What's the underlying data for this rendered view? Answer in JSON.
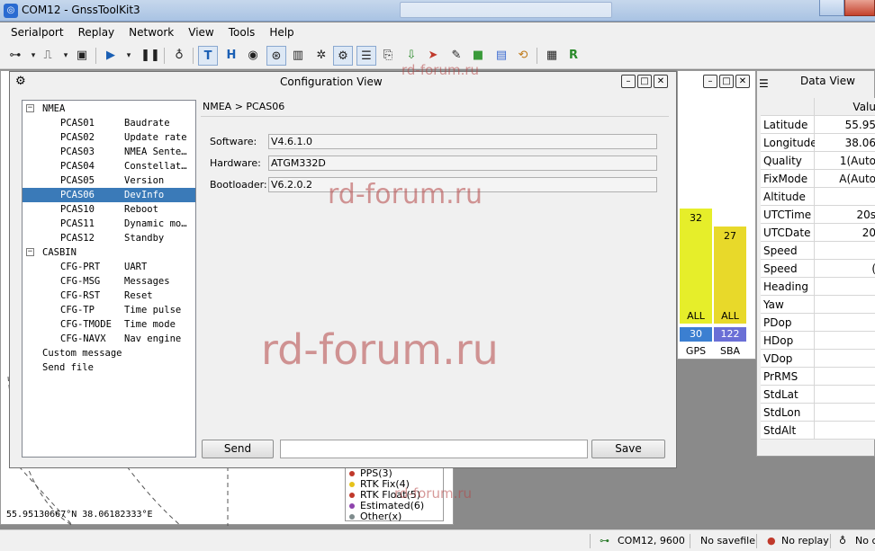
{
  "window": {
    "title": "COM12 - GnssToolKit3"
  },
  "menu": [
    "Serialport",
    "Replay",
    "Network",
    "View",
    "Tools",
    "Help"
  ],
  "toolbar": {
    "icons": [
      "serial-connect-icon",
      "signal-wave-icon",
      "save-icon",
      "play-icon",
      "pause-icon",
      "microphone-icon",
      "text-view-icon",
      "hex-view-icon",
      "compass-icon",
      "target-icon",
      "bar-chart-icon",
      "satellite-icon",
      "gear-icon",
      "list-icon",
      "document-icon",
      "download-icon",
      "arrow-icon",
      "pen-icon",
      "green-box-icon",
      "sbas-icon",
      "refresh-icon",
      "layout-icon",
      "r-box-icon"
    ]
  },
  "config_dialog": {
    "title": "Configuration View",
    "breadcrumb": "NMEA > PCAS06",
    "tree": [
      {
        "level": 0,
        "expand": "−",
        "a": "NMEA",
        "b": ""
      },
      {
        "level": 1,
        "a": "PCAS01",
        "b": "Baudrate"
      },
      {
        "level": 1,
        "a": "PCAS02",
        "b": "Update rate"
      },
      {
        "level": 1,
        "a": "PCAS03",
        "b": "NMEA Sente…"
      },
      {
        "level": 1,
        "a": "PCAS04",
        "b": "Constellat…"
      },
      {
        "level": 1,
        "a": "PCAS05",
        "b": "Version"
      },
      {
        "level": 1,
        "a": "PCAS06",
        "b": "DevInfo",
        "selected": true
      },
      {
        "level": 1,
        "a": "PCAS10",
        "b": "Reboot"
      },
      {
        "level": 1,
        "a": "PCAS11",
        "b": "Dynamic mo…"
      },
      {
        "level": 1,
        "a": "PCAS12",
        "b": "Standby"
      },
      {
        "level": 0,
        "expand": "−",
        "a": "CASBIN",
        "b": ""
      },
      {
        "level": 1,
        "a": "CFG-PRT",
        "b": "UART"
      },
      {
        "level": 1,
        "a": "CFG-MSG",
        "b": "Messages"
      },
      {
        "level": 1,
        "a": "CFG-RST",
        "b": "Reset"
      },
      {
        "level": 1,
        "a": "CFG-TP",
        "b": "Time pulse"
      },
      {
        "level": 1,
        "a": "CFG-TMODE",
        "b": "Time mode"
      },
      {
        "level": 1,
        "a": "CFG-NAVX",
        "b": "Nav engine"
      },
      {
        "level": 0,
        "a": "Custom message",
        "b": ""
      },
      {
        "level": 0,
        "a": "Send file",
        "b": ""
      }
    ],
    "fields": [
      {
        "label": "Software:",
        "value": "V4.6.1.0"
      },
      {
        "label": "Hardware:",
        "value": "ATGM332D"
      },
      {
        "label": "Bootloader:",
        "value": "V6.2.0.2"
      }
    ],
    "send_label": "Send",
    "save_label": "Save",
    "send_value": ""
  },
  "satellites": [
    {
      "name": "GPS",
      "signal": 32,
      "count": 30,
      "all": "ALL",
      "bar_color": "#e6ee2a",
      "count_color": "#3b7fd1"
    },
    {
      "name": "SBA",
      "signal": 27,
      "count": 122,
      "all": "ALL",
      "bar_color": "#e8d92a",
      "count_color": "#6a6fd6"
    }
  ],
  "data_view": {
    "title": "Data View",
    "header": "Valu",
    "rows": [
      {
        "key": "Latitude",
        "value": "55.95"
      },
      {
        "key": "Longitude",
        "value": "38.06"
      },
      {
        "key": "Quality",
        "value": "1(Auto"
      },
      {
        "key": "FixMode",
        "value": "A(Auto"
      },
      {
        "key": "Altitude",
        "value": ""
      },
      {
        "key": "UTCTime",
        "value": "20s"
      },
      {
        "key": "UTCDate",
        "value": "20"
      },
      {
        "key": "Speed",
        "value": ""
      },
      {
        "key": "Speed",
        "value": "("
      },
      {
        "key": "Heading",
        "value": ""
      },
      {
        "key": "Yaw",
        "value": ""
      },
      {
        "key": "PDop",
        "value": ""
      },
      {
        "key": "HDop",
        "value": ""
      },
      {
        "key": "VDop",
        "value": ""
      },
      {
        "key": "PrRMS",
        "value": ""
      },
      {
        "key": "StdLat",
        "value": ""
      },
      {
        "key": "StdLon",
        "value": ""
      },
      {
        "key": "StdAlt",
        "value": ""
      }
    ]
  },
  "map": {
    "coords": "55.95130667°N 38.06182333°E"
  },
  "legend": [
    {
      "label": "PPS(3)",
      "color": "#c0392b"
    },
    {
      "label": "RTK Fix(4)",
      "color": "#e6c21a"
    },
    {
      "label": "RTK Float(5)",
      "color": "#c0392b"
    },
    {
      "label": "Estimated(6)",
      "color": "#8e44ad"
    },
    {
      "label": "Other(x)",
      "color": "#7f8c8d"
    }
  ],
  "watermark": "rd-forum.ru",
  "statusbar": {
    "port": "COM12, 9600",
    "savefile": "No savefile",
    "replay": "No replay",
    "extra": "No c"
  }
}
